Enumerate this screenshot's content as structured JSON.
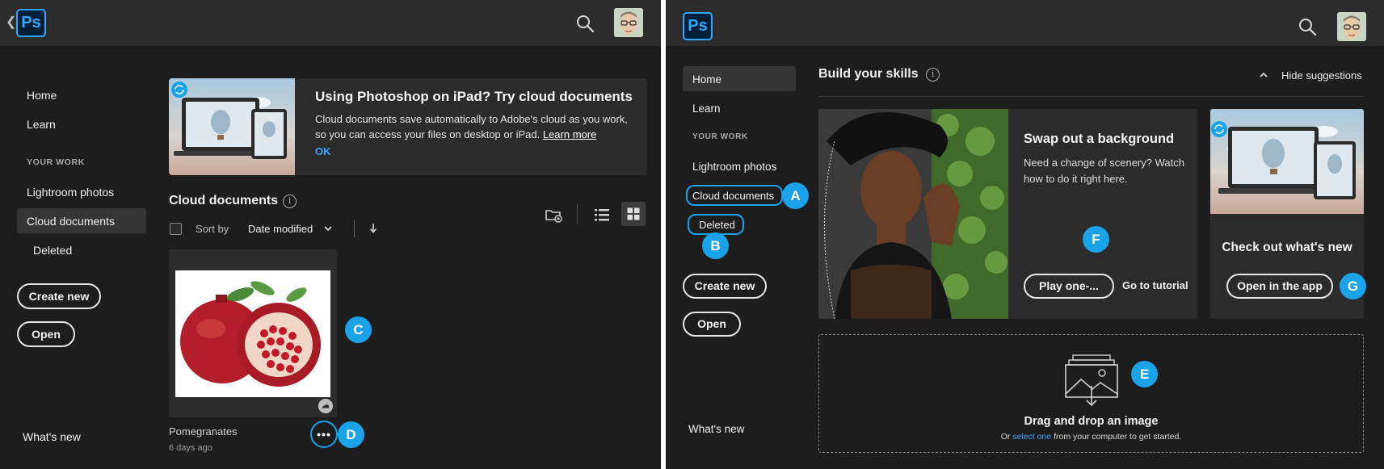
{
  "app": {
    "logo": "Ps"
  },
  "left": {
    "nav": {
      "home": "Home",
      "learn": "Learn",
      "section": "YOUR WORK",
      "lightroom": "Lightroom photos",
      "cloud_documents": "Cloud documents",
      "deleted": "Deleted",
      "create_new": "Create new",
      "open": "Open",
      "whats_new": "What's new"
    },
    "banner": {
      "title": "Using Photoshop on iPad? Try cloud documents",
      "body": "Cloud documents save automatically to Adobe's cloud as you work, so you can access your files on desktop or iPad.",
      "link": "Learn more",
      "ok": "OK"
    },
    "cloud": {
      "title": "Cloud documents",
      "info": "i",
      "sort_by_label": "Sort by",
      "sort_value": "Date modified"
    },
    "file": {
      "name": "Pomegranates",
      "date": "6 days ago",
      "more": "•••"
    },
    "badges": {
      "c": "C",
      "d": "D"
    }
  },
  "right": {
    "nav": {
      "home": "Home",
      "learn": "Learn",
      "section": "YOUR WORK",
      "lightroom": "Lightroom photos",
      "cloud_documents": "Cloud documents",
      "deleted": "Deleted",
      "create_new": "Create new",
      "open": "Open",
      "whats_new": "What's new"
    },
    "skills": {
      "title": "Build your skills",
      "info": "i",
      "hide": "Hide suggestions"
    },
    "tutorial": {
      "title": "Swap out a background",
      "body": "Need a change of scenery? Watch how to do it right here.",
      "play": "Play one-...",
      "go": "Go to tutorial"
    },
    "whats_new_card": {
      "title": "Check out what's new",
      "button": "Open in the app"
    },
    "dropzone": {
      "title": "Drag and drop an image",
      "prefix": "Or",
      "link": "select one",
      "suffix": "from your computer to get started."
    },
    "badges": {
      "a": "A",
      "b": "B",
      "e": "E",
      "f": "F",
      "g": "G"
    }
  },
  "colors": {
    "accent": "#1aa3e8",
    "link": "#3ea4ff",
    "ps_blue": "#31a8ff",
    "background": "#1d1d1d",
    "topbar": "#2c2c2c"
  },
  "icons": [
    "back-chevron-icon",
    "search-icon",
    "cloud-sync-icon",
    "info-icon",
    "new-folder-icon",
    "list-view-icon",
    "grid-view-icon",
    "sort-direction-icon",
    "cloud-icon",
    "chevron-up-icon",
    "image-upload-icon"
  ]
}
